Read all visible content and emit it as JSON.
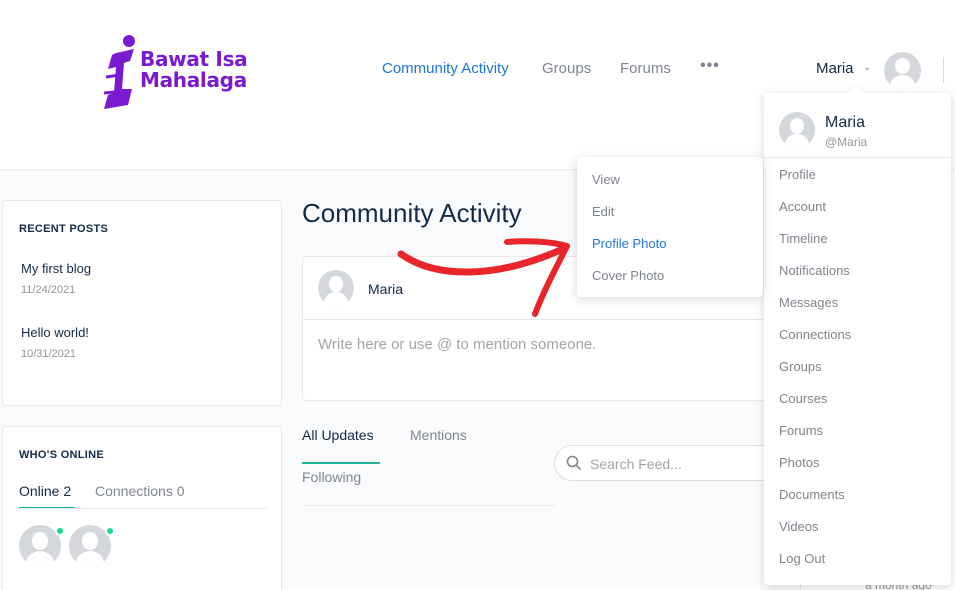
{
  "brand": {
    "logo_line1": "Bawat Isa",
    "logo_line2": "Mahalaga",
    "color": "#7a1bd1"
  },
  "nav": {
    "items": [
      "Community Activity",
      "Groups",
      "Forums"
    ],
    "more_icon": "more-horizontal-icon",
    "active_color": "#1d76da"
  },
  "user": {
    "name": "Maria",
    "handle": "@Maria"
  },
  "recent_posts": {
    "title": "RECENT POSTS",
    "posts": [
      {
        "title": "My first blog",
        "date": "11/24/2021"
      },
      {
        "title": "Hello world!",
        "date": "10/31/2021"
      }
    ]
  },
  "whos_online": {
    "title": "WHO'S ONLINE",
    "tabs": [
      "Online 2",
      "Connections 0"
    ],
    "online_color": "#1cd991"
  },
  "main": {
    "title": "Community Activity",
    "composer_name": "Maria",
    "composer_placeholder": "Write here or use @ to mention someone.",
    "feed_tabs": [
      "All Updates",
      "Mentions",
      "Following"
    ],
    "search_placeholder": "Search Feed..."
  },
  "user_menu": {
    "items": [
      "Profile",
      "Account",
      "Timeline",
      "Notifications",
      "Messages",
      "Connections",
      "Groups",
      "Courses",
      "Forums",
      "Photos",
      "Documents",
      "Videos",
      "Log Out"
    ]
  },
  "profile_submenu": {
    "items": [
      "View",
      "Edit",
      "Profile Photo",
      "Cover Photo"
    ],
    "active_index": 2
  },
  "background_fragment": {
    "timestamp": "a month ago"
  },
  "annotation": {
    "arrow_color": "#e8252a"
  }
}
